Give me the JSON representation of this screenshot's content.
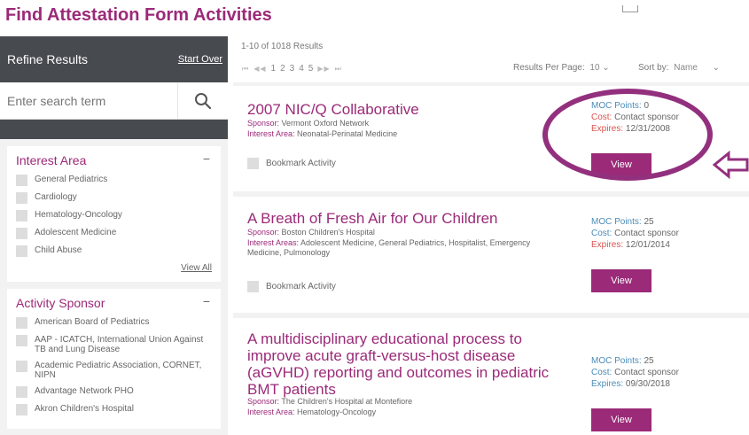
{
  "page": {
    "title": "Find Attestation Form Activities"
  },
  "sidebar": {
    "refine_title": "Refine Results",
    "start_over": "Start Over",
    "search_placeholder": "Enter search term",
    "search_icon": "search-icon",
    "interest_area": {
      "title": "Interest Area",
      "toggle": "−",
      "items": [
        "General Pediatrics",
        "Cardiology",
        "Hematology-Oncology",
        "Adolescent Medicine",
        "Child Abuse"
      ],
      "view_all": "View All"
    },
    "activity_sponsor": {
      "title": "Activity Sponsor",
      "toggle": "−",
      "items": [
        "American Board of Pediatrics",
        "AAP - ICATCH, International Union Against TB and Lung Disease",
        "Academic Pediatric Association, CORNET, NIPN",
        "Advantage Network PHO",
        "Akron Children's Hospital"
      ]
    }
  },
  "results": {
    "count_text": "1-10 of 1018 Results",
    "pager": {
      "first": "⏮",
      "prev": "◀◀",
      "pages": [
        "1",
        "2",
        "3",
        "4",
        "5"
      ],
      "next": "▶▶",
      "last": "⏭"
    },
    "per_page_label": "Results Per Page:",
    "per_page_value": "10",
    "sort_label": "Sort by:",
    "sort_value": "Name",
    "bookmark_label": "Bookmark Activity",
    "view_label": "View",
    "items": [
      {
        "title": "2007 NIC/Q Collaborative",
        "sponsor_label": "Sponsor:",
        "sponsor": "Vermont Oxford Network",
        "interest_label": "Interest Area:",
        "interest": "Neonatal-Perinatal Medicine",
        "moc_label": "MOC Points:",
        "moc": "0",
        "cost_label": "Cost:",
        "cost": "Contact sponsor",
        "expires_label": "Expires:",
        "expires": "12/31/2008"
      },
      {
        "title": "A Breath of Fresh Air for Our Children",
        "sponsor_label": "Sponsor:",
        "sponsor": "Boston Children's Hospital",
        "interest_label": "Interest Areas:",
        "interest": "Adolescent Medicine, General Pediatrics, Hospitalist, Emergency Medicine, Pulmonology",
        "moc_label": "MOC Points:",
        "moc": "25",
        "cost_label": "Cost:",
        "cost": "Contact sponsor",
        "expires_label": "Expires:",
        "expires": "12/01/2014"
      },
      {
        "title": "A multidisciplinary educational process to improve acute graft-versus-host disease (aGVHD) reporting and outcomes in pediatric BMT patients",
        "sponsor_label": "Sponsor:",
        "sponsor": "The Children's Hospital at Montefiore",
        "interest_label": "Interest Area:",
        "interest": "Hematology-Oncology",
        "moc_label": "MOC Points:",
        "moc": "25",
        "cost_label": "Cost:",
        "cost": "Contact sponsor",
        "expires_label": "Expires:",
        "expires": "09/30/2018"
      }
    ]
  },
  "annotation": {
    "color": "#93307e",
    "arrow_icon": "left-arrow-icon"
  }
}
